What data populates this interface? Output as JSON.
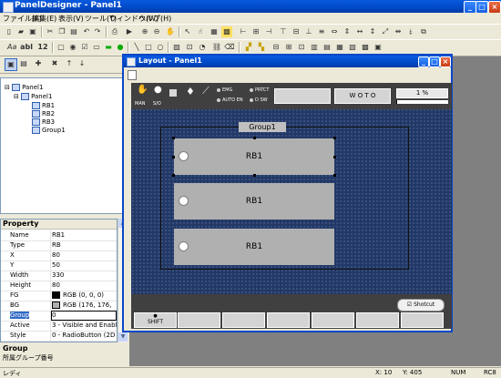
{
  "app": {
    "title": "PanelDesigner - Panel1",
    "menu": [
      "ファイル(F)",
      "編集(E)",
      "表示(V)",
      "ツール(T)",
      "ウィンドウ(W)",
      "ヘルプ(H)"
    ]
  },
  "toolbar": {
    "text_tools": [
      "Aa",
      "abl",
      "12"
    ]
  },
  "tree": {
    "root": "Panel1",
    "panel": "Panel1",
    "items": [
      "RB1",
      "RB2",
      "RB3",
      "Group1"
    ]
  },
  "properties": {
    "header": "Property",
    "rows": [
      {
        "key": "Name",
        "value": "RB1"
      },
      {
        "key": "Type",
        "value": "RB"
      },
      {
        "key": "X",
        "value": "80"
      },
      {
        "key": "Y",
        "value": "50"
      },
      {
        "key": "Width",
        "value": "330"
      },
      {
        "key": "Height",
        "value": "80"
      },
      {
        "key": "FG",
        "value": "RGB (0, 0, 0)"
      },
      {
        "key": "BG",
        "value": "RGB (176, 176,"
      },
      {
        "key": "Group",
        "value": "0"
      },
      {
        "key": "Active",
        "value": "3 - Visible and Enable"
      },
      {
        "key": "Style",
        "value": "0 - RadioButton (2D"
      }
    ],
    "colors": {
      "fg": "#000000",
      "bg": "#b0b0b0"
    },
    "desc_title": "Group",
    "desc_text": "所属グループ番号"
  },
  "layout_window": {
    "title": "Layout - Panel1",
    "status_labels": [
      "MAN",
      "S/O"
    ],
    "indicators": [
      "EMG",
      "PRTCT",
      "AUTO EN",
      "D SW"
    ],
    "button_wo": "W O T O",
    "progress_label": "1 %",
    "group_label": "Group1",
    "radio_buttons": [
      "RB1",
      "RB1",
      "RB1"
    ],
    "shortcut_label": "Shotcut",
    "shift_label": "SHIFT"
  },
  "statusbar": {
    "left": "レディ",
    "x": "X:  10",
    "y": "Y: 405",
    "num": "NUM",
    "rc": "RC8"
  }
}
